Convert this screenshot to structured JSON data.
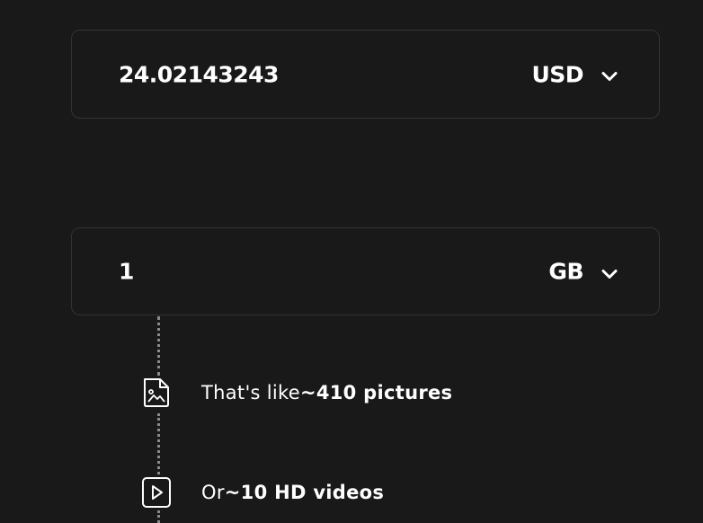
{
  "converter": {
    "amount": {
      "value": "24.02143243",
      "unit": "USD",
      "unit_icon": "chevron-down-icon"
    },
    "data": {
      "value": "1",
      "unit": "GB",
      "unit_icon": "chevron-down-icon"
    }
  },
  "equivalents": [
    {
      "icon": "image-file-icon",
      "prefix": "That's like",
      "value": "~410 pictures"
    },
    {
      "icon": "video-play-icon",
      "prefix": "Or",
      "value": "~10 HD videos"
    }
  ],
  "colors": {
    "background": "#191919",
    "border": "#333333",
    "text": "#ffffff",
    "dots": "#8a8a8a"
  }
}
